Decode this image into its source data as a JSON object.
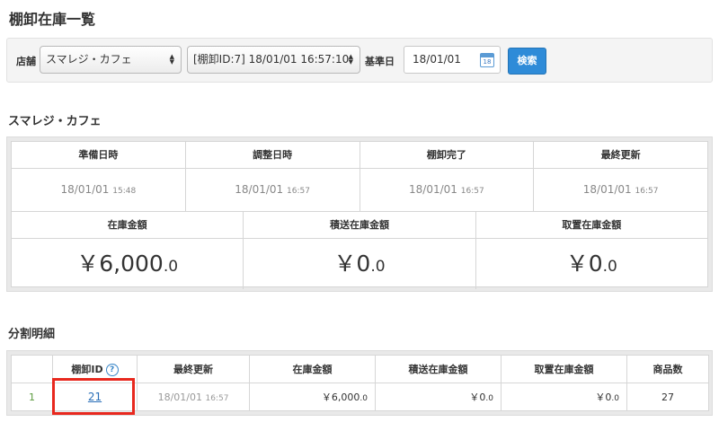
{
  "page": {
    "title": "棚卸在庫一覧"
  },
  "filter": {
    "store_label": "店舗",
    "store_value": "スマレジ・カフェ",
    "inventory_value": "[棚卸ID:7] 18/01/01 16:57:10",
    "base_date_label": "基準日",
    "base_date_value": "18/01/01",
    "calendar_day": "18",
    "search_label": "検索"
  },
  "summary": {
    "title": "スマレジ・カフェ",
    "row1": [
      {
        "label": "準備日時",
        "date": "18/01/01",
        "time": "15:48"
      },
      {
        "label": "調整日時",
        "date": "18/01/01",
        "time": "16:57"
      },
      {
        "label": "棚卸完了",
        "date": "18/01/01",
        "time": "16:57"
      },
      {
        "label": "最終更新",
        "date": "18/01/01",
        "time": "16:57"
      }
    ],
    "row2": [
      {
        "label": "在庫金額",
        "amount": "￥6,000",
        "decimal": ".0"
      },
      {
        "label": "積送在庫金額",
        "amount": "￥0",
        "decimal": ".0"
      },
      {
        "label": "取置在庫金額",
        "amount": "￥0",
        "decimal": ".0"
      }
    ]
  },
  "detail": {
    "title": "分割明細",
    "headers": [
      "",
      "棚卸ID",
      "最終更新",
      "在庫金額",
      "積送在庫金額",
      "取置在庫金額",
      "商品数"
    ],
    "help_glyph": "?",
    "rows": [
      {
        "no": "1",
        "id": "21",
        "date": "18/01/01",
        "time": "16:57",
        "stock_amount": "￥6,000",
        "stock_decimal": ".0",
        "transit_amount": "￥0",
        "transit_decimal": ".0",
        "reserved_amount": "￥0",
        "reserved_decimal": ".0",
        "item_count": "27"
      }
    ]
  },
  "colors": {
    "accent": "#2e8bd8",
    "highlight": "#e8281e",
    "link": "#2a6fb8"
  }
}
